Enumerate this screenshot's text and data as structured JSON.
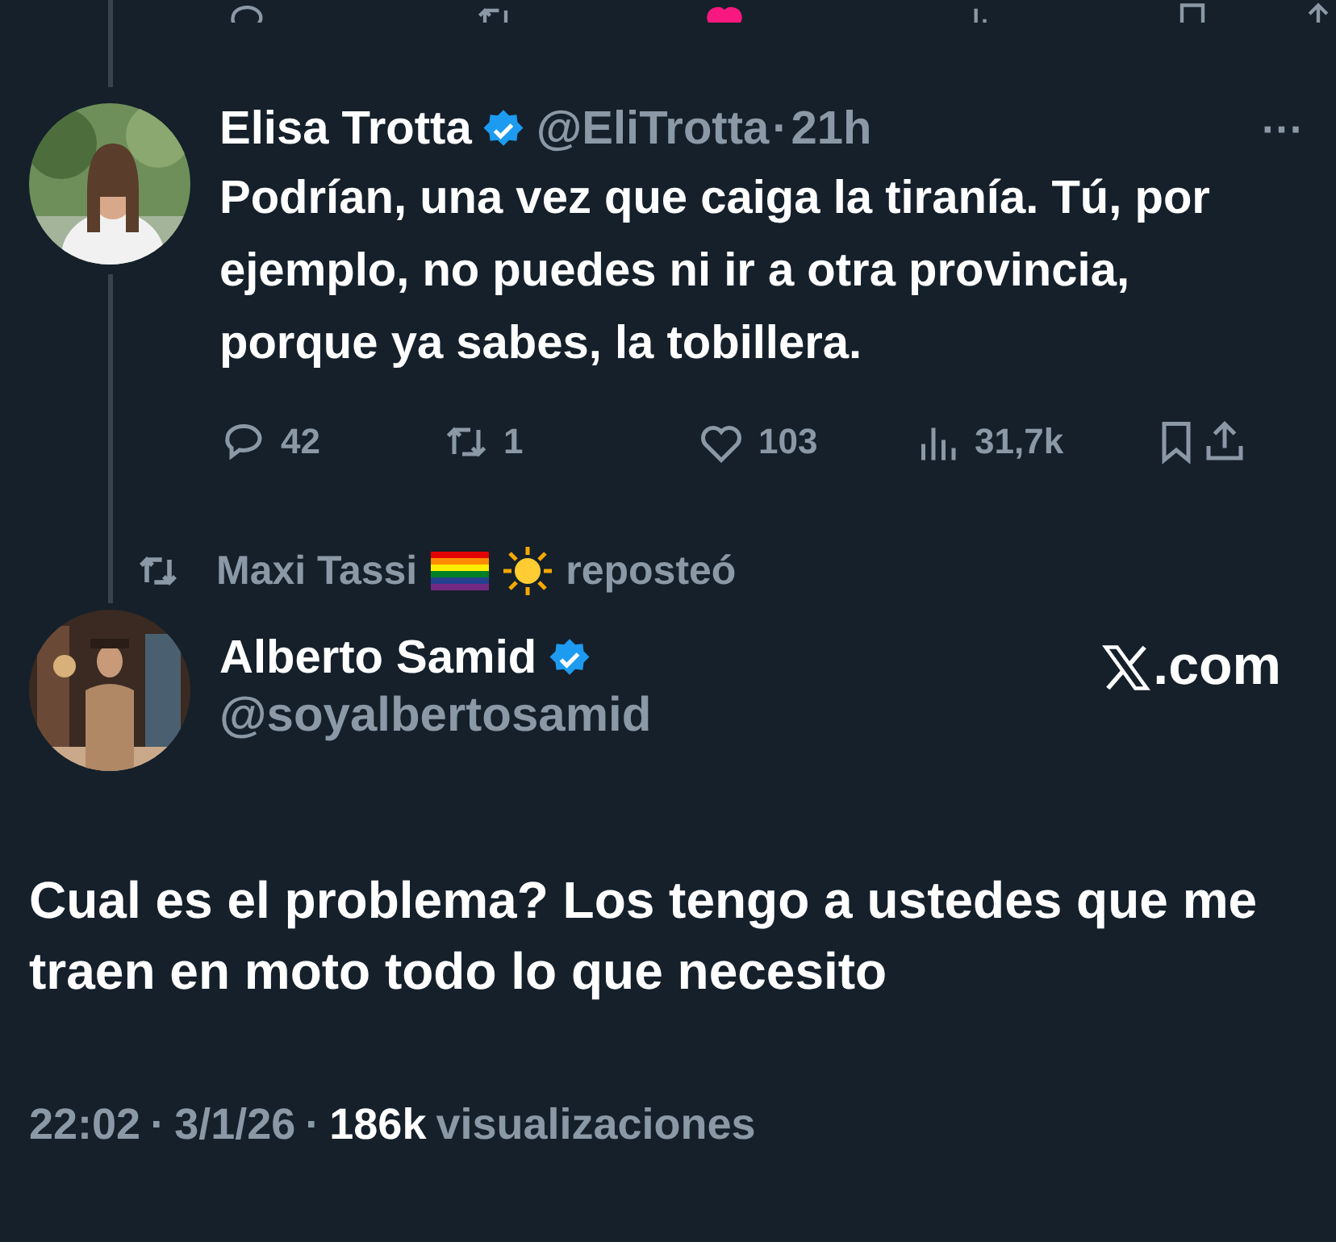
{
  "top_actions": {
    "liked": true
  },
  "reply": {
    "name": "Elisa Trotta",
    "verified": true,
    "handle": "@EliTrotta",
    "separator": "·",
    "time": "21h",
    "more": "···",
    "text": "Podrían, una vez que caiga la tiranía. Tú, por ejemplo, no puedes ni ir a otra provincia, porque ya sabes, la tobillera.",
    "stats": {
      "replies": "42",
      "reposts": "1",
      "likes": "103",
      "views": "31,7k",
      "liked": false
    }
  },
  "repost_banner": {
    "name": "Maxi Tassi",
    "action": "reposteó"
  },
  "post": {
    "name": "Alberto Samid",
    "verified": true,
    "handle": "@soyalbertosamid",
    "site": ".com",
    "text": "Cual es el problema? Los tengo a ustedes que me traen en moto todo lo que necesito",
    "time": "22:02",
    "separator": "·",
    "date": "3/1/26",
    "views_count": "186k",
    "views_label": "visualizaciones"
  }
}
